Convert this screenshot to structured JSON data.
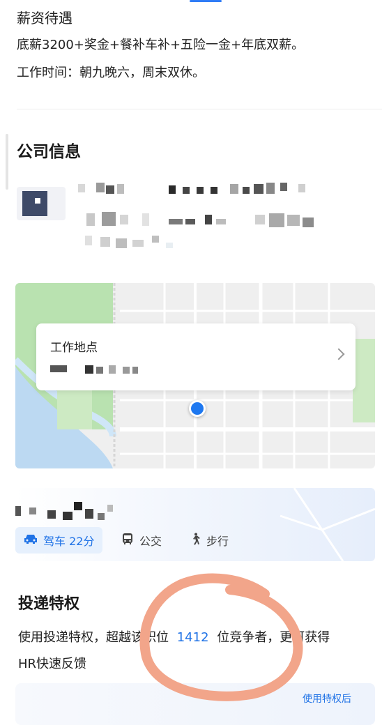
{
  "salary": {
    "title": "薪资待遇",
    "line1": "底薪3200+奖金+餐补车补+五险一金+年底双薪。",
    "line2": "工作时间：朝九晚六，周末双休。"
  },
  "company": {
    "title": "公司信息"
  },
  "location": {
    "card_title": "工作地点"
  },
  "route": {
    "tabs": [
      {
        "label": "驾车 22分",
        "icon": "car-icon"
      },
      {
        "label": "公交",
        "icon": "bus-icon"
      },
      {
        "label": "步行",
        "icon": "walk-icon"
      }
    ]
  },
  "perks": {
    "title": "投递特权",
    "text_before": "使用投递特权，超越该职位",
    "count": "1412",
    "text_after": "位竞争者，更可获得",
    "line2": "HR快速反馈",
    "card_label": "使用特权后"
  },
  "colors": {
    "accent": "#1f72e6",
    "annotation": "#f2a58a"
  }
}
